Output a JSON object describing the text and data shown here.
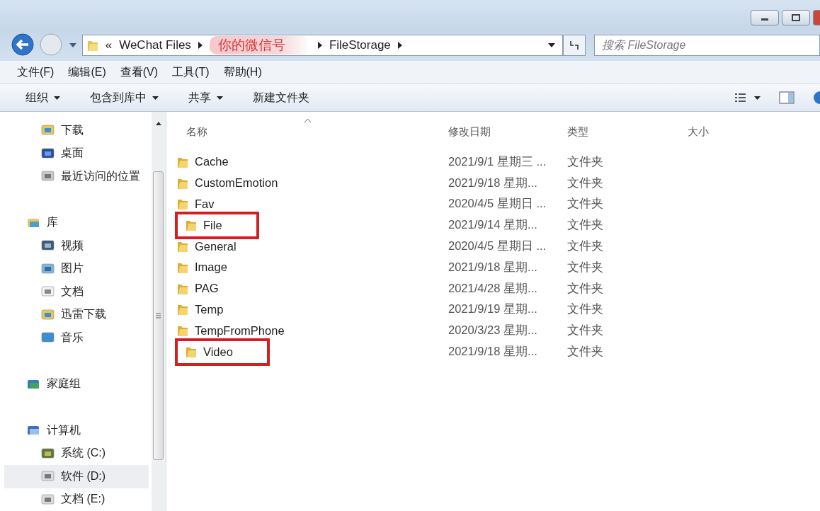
{
  "address": {
    "overflow": "«",
    "segments": [
      {
        "label": "WeChat Files",
        "kind": "folder"
      },
      {
        "label": "你的微信号",
        "kind": "annotation"
      },
      {
        "label": "FileStorage",
        "kind": "folder"
      }
    ]
  },
  "search": {
    "placeholder": "搜索 FileStorage"
  },
  "menu": [
    "文件(F)",
    "编辑(E)",
    "查看(V)",
    "工具(T)",
    "帮助(H)"
  ],
  "toolbar": [
    {
      "label": "组织",
      "dropdown": true
    },
    {
      "label": "包含到库中",
      "dropdown": true
    },
    {
      "label": "共享",
      "dropdown": true
    },
    {
      "label": "新建文件夹",
      "dropdown": false
    }
  ],
  "sidebar": {
    "groups": [
      {
        "children": [
          {
            "label": "下载",
            "kind": "download",
            "selected": false
          },
          {
            "label": "桌面",
            "kind": "desktop",
            "selected": false
          },
          {
            "label": "最近访问的位置",
            "kind": "recent",
            "selected": false
          }
        ]
      },
      {
        "label": "库",
        "kind": "library",
        "children": [
          {
            "label": "视频",
            "kind": "video",
            "selected": false
          },
          {
            "label": "图片",
            "kind": "picture",
            "selected": false
          },
          {
            "label": "文档",
            "kind": "document",
            "selected": false
          },
          {
            "label": "迅雷下载",
            "kind": "download",
            "selected": false
          },
          {
            "label": "音乐",
            "kind": "music",
            "selected": false
          }
        ]
      },
      {
        "label": "家庭组",
        "kind": "homegroup"
      },
      {
        "label": "计算机",
        "kind": "computer",
        "children": [
          {
            "label": "系统 (C:)",
            "kind": "system-drive",
            "selected": false
          },
          {
            "label": "软件 (D:)",
            "kind": "drive",
            "selected": true
          },
          {
            "label": "文档 (E:)",
            "kind": "drive",
            "selected": false
          }
        ]
      }
    ]
  },
  "columns": [
    {
      "label": "名称",
      "sorted": true
    },
    {
      "label": "修改日期",
      "sorted": false
    },
    {
      "label": "类型",
      "sorted": false
    },
    {
      "label": "大小",
      "sorted": false
    }
  ],
  "rows": [
    {
      "name": "Cache",
      "modified": "2021/9/1 星期三 ...",
      "type": "文件夹",
      "highlighted": false
    },
    {
      "name": "CustomEmotion",
      "modified": "2021/9/18 星期...",
      "type": "文件夹",
      "highlighted": false
    },
    {
      "name": "Fav",
      "modified": "2020/4/5 星期日 ...",
      "type": "文件夹",
      "highlighted": false
    },
    {
      "name": "File",
      "modified": "2021/9/14 星期...",
      "type": "文件夹",
      "highlighted": true
    },
    {
      "name": "General",
      "modified": "2020/4/5 星期日 ...",
      "type": "文件夹",
      "highlighted": false
    },
    {
      "name": "Image",
      "modified": "2021/9/18 星期...",
      "type": "文件夹",
      "highlighted": false
    },
    {
      "name": "PAG",
      "modified": "2021/4/28 星期...",
      "type": "文件夹",
      "highlighted": false
    },
    {
      "name": "Temp",
      "modified": "2021/9/19 星期...",
      "type": "文件夹",
      "highlighted": false
    },
    {
      "name": "TempFromPhone",
      "modified": "2020/3/23 星期...",
      "type": "文件夹",
      "highlighted": false
    },
    {
      "name": "Video",
      "modified": "2021/9/18 星期...",
      "type": "文件夹",
      "highlighted": true
    }
  ]
}
